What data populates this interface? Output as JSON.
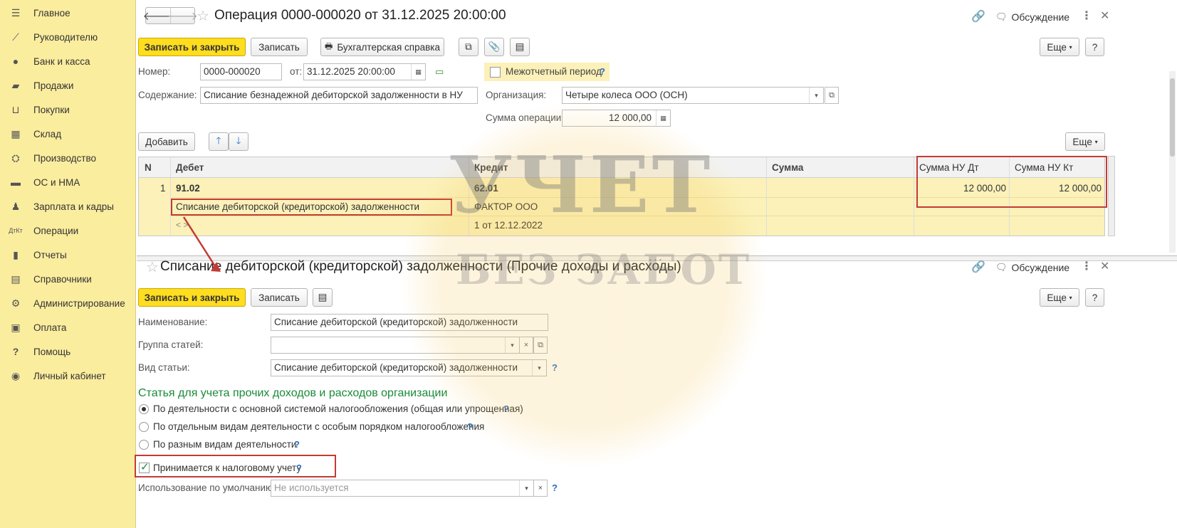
{
  "sidebar": {
    "items": [
      {
        "label": "Главное",
        "icon": "menu-icon"
      },
      {
        "label": "Руководителю",
        "icon": "chart-trend-icon"
      },
      {
        "label": "Банк и касса",
        "icon": "ruble-coin-icon"
      },
      {
        "label": "Продажи",
        "icon": "shopping-bag-icon"
      },
      {
        "label": "Покупки",
        "icon": "cart-icon"
      },
      {
        "label": "Склад",
        "icon": "warehouse-grid-icon"
      },
      {
        "label": "Производство",
        "icon": "factory-icon"
      },
      {
        "label": "ОС и НМА",
        "icon": "truck-icon"
      },
      {
        "label": "Зарплата и кадры",
        "icon": "person-icon"
      },
      {
        "label": "Операции",
        "icon": "dt-kt-icon"
      },
      {
        "label": "Отчеты",
        "icon": "bar-chart-icon"
      },
      {
        "label": "Справочники",
        "icon": "book-icon"
      },
      {
        "label": "Администрирование",
        "icon": "gear-icon"
      },
      {
        "label": "Оплата",
        "icon": "wallet-icon"
      },
      {
        "label": "Помощь",
        "icon": "question-icon"
      },
      {
        "label": "Личный кабинет",
        "icon": "user-circle-icon"
      }
    ]
  },
  "operation": {
    "title": "Операция 0000-000020 от 31.12.2025 20:00:00",
    "discuss_label": "Обсуждение",
    "toolbar": {
      "save_close": "Записать и закрыть",
      "save": "Записать",
      "accounting_ref": "Бухгалтерская справка",
      "more": "Еще",
      "help": "?"
    },
    "number_label": "Номер:",
    "number_value": "0000-000020",
    "date_label": "от:",
    "date_value": "31.12.2025 20:00:00",
    "interperiod_label": "Межотчетный период",
    "content_label": "Содержание:",
    "content_value": "Списание безнадежной дебиторской задолженности в НУ",
    "org_label": "Организация:",
    "org_value": "Четыре колеса ООО (ОСН)",
    "sum_label": "Сумма операции:",
    "sum_value": "12 000,00",
    "table_toolbar": {
      "add": "Добавить",
      "more": "Еще"
    },
    "table": {
      "headers": {
        "n": "N",
        "debit": "Дебет",
        "credit": "Кредит",
        "sum": "Сумма",
        "nu_dt": "Сумма НУ Дт",
        "nu_kt": "Сумма НУ Кт"
      },
      "row": {
        "n": "1",
        "debit_account": "91.02",
        "debit_sub1": "Списание дебиторской (кредиторской) задолженности",
        "debit_sub2": "< >",
        "credit_account": "62.01",
        "credit_sub1": "ФАКТОР ООО",
        "credit_sub2": "1 от 12.12.2022",
        "nu_dt": "12 000,00",
        "nu_kt": "12 000,00"
      }
    }
  },
  "item": {
    "title": "Списание дебиторской (кредиторской) задолженности (Прочие доходы и расходы)",
    "discuss_label": "Обсуждение",
    "toolbar": {
      "save_close": "Записать и закрыть",
      "save": "Записать",
      "more": "Еще",
      "help": "?"
    },
    "name_label": "Наименование:",
    "name_value": "Списание дебиторской (кредиторской) задолженности",
    "group_label": "Группа статей:",
    "group_value": "",
    "kind_label": "Вид статьи:",
    "kind_value": "Списание дебиторской (кредиторской) задолженности",
    "section_title": "Статья для учета прочих доходов и расходов организации",
    "radio_options": [
      "По деятельности с основной системой налогообложения (общая или упрощенная)",
      "По отдельным видам деятельности с особым порядком налогообложения",
      "По разным видам деятельности"
    ],
    "selected_option": 0,
    "tax_accounting_label": "Принимается к налоговому учету",
    "tax_accounting_checked": true,
    "default_use_label": "Использование по умолчанию:",
    "default_use_placeholder": "Не используется"
  },
  "watermark": {
    "line1": "УЧЕТ",
    "line2": "БЕЗ ЗАБОТ"
  },
  "colors": {
    "sidebar_bg": "#fbed9e",
    "primary_button": "#ffdd1f",
    "highlight_red": "#c33b35",
    "section_green": "#1a8a3a",
    "help_blue": "#2d6fc2",
    "row_selected": "#fbf1b9"
  }
}
